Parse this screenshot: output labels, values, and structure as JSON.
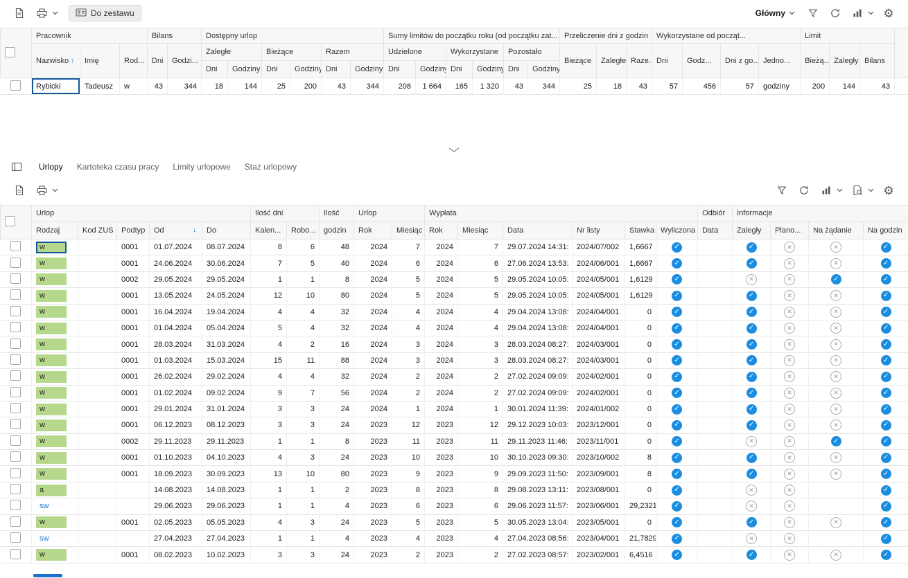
{
  "colors": {
    "accent_blue": "#1b8de0",
    "focus_border": "#12599c",
    "leave_green": "#b6d88d",
    "link_blue": "#1d79d2",
    "cross_gray": "#9c9c9c",
    "scrollbar_blue": "#1e6fd0",
    "header_bg": "#f7f7f7"
  },
  "toolbar_top": {
    "icons": [
      "open-icon",
      "print-icon",
      "print-dropdown-chevron-icon"
    ],
    "to_set_button_label": "Do zestawu",
    "view_selector_label": "Główny",
    "right_icons": [
      "filter-icon",
      "refresh-icon",
      "chart-icon",
      "chart-dropdown-chevron-icon",
      "settings-icon"
    ]
  },
  "employee_grid": {
    "sort": {
      "column": "Nazwisko",
      "direction": "asc"
    },
    "group_headers": {
      "pracownik": "Pracownik",
      "bilans": "Bilans",
      "dostepny_urlop": "Dostępny urlop",
      "sumy_limitow": "Sumy limitów do początku roku (od początku zat...",
      "przeliczenie": "Przeliczenie dni z godzin",
      "wykorzystane_od": "Wykorzystane od począt...",
      "limit": "Limit"
    },
    "sub_headers": {
      "nazwisko": "Nazwisko",
      "imie": "Imię",
      "rodzaj": "Rod...",
      "dni": "Dni",
      "godzi": "Godzi...",
      "zalegle": "Zaległe",
      "biezace": "Bieżące",
      "razem": "Razem",
      "udzielone": "Udzielone",
      "wykorzystane": "Wykorzystane",
      "pozostalo": "Pozostało",
      "raze": "Raze...",
      "godz": "Godz...",
      "dni_z_go": "Dni z go...",
      "jedno": "Jedno...",
      "bieza": "Bieżą...",
      "zalegly": "Zaległy",
      "bilans": "Bilans",
      "godziny": "Godziny"
    },
    "row": {
      "nazwisko": "Rybicki",
      "imie": "Tadeusz",
      "rodzaj": "w",
      "bilans_dni": "43",
      "bilans_godziny": "344",
      "zalegle_dni": "18",
      "zalegle_godziny": "144",
      "biezace_dni": "25",
      "biezace_godziny": "200",
      "razem_dni": "43",
      "razem_godziny": "344",
      "udzielone_dni": "208",
      "udzielone_godziny": "1 664",
      "wykorzystane_dni": "165",
      "wykorzystane_godziny": "1 320",
      "pozostalo_dni": "43",
      "pozostalo_godziny": "344",
      "przeliczenie_biezace": "25",
      "przeliczenie_zalegle": "18",
      "przeliczenie_razem": "43",
      "wyk_dni": "57",
      "wyk_godz": "456",
      "wyk_dni_z_godzin": "57",
      "wyk_jednostka": "godziny",
      "limit_biezacy": "200",
      "limit_zalegly": "144",
      "limit_bilans": "43"
    }
  },
  "splitter": {
    "icon": "collapse-chevron-icon"
  },
  "tabs": {
    "panel_icon": "panel-icon",
    "items": [
      {
        "label": "Urlopy",
        "active": true
      },
      {
        "label": "Kartoteka czasu pracy",
        "active": false
      },
      {
        "label": "Limity urlopowe",
        "active": false
      },
      {
        "label": "Staż urlopowy",
        "active": false
      }
    ]
  },
  "toolbar_leaves": {
    "icons": [
      "open-icon",
      "print-icon",
      "print-dropdown-chevron-icon"
    ],
    "right_icons": [
      "filter-icon",
      "refresh-icon",
      "chart-icon",
      "chart-dropdown-chevron-icon",
      "preview-icon",
      "preview-dropdown-chevron-icon",
      "settings-icon"
    ]
  },
  "leave_grid": {
    "sort": {
      "column": "Od",
      "direction": "desc"
    },
    "group_headers": {
      "urlop": "Urlop",
      "ilosc_dni": "Ilość dni",
      "ilosc": "Ilość",
      "urlop2": "Urlop",
      "wyplata": "Wypłata",
      "odbior": "Odbiór",
      "informacje": "Informacje"
    },
    "columns": {
      "rodzaj": "Rodzaj",
      "kod_zus": "Kod ZUS",
      "podtyp": "Podtyp",
      "od": "Od",
      "do": "Do",
      "kalen": "Kalen...",
      "robo": "Robo...",
      "godzin": "godzin",
      "rok": "Rok",
      "miesiac": "Miesiąc",
      "rok2": "Rok",
      "miesiac2": "Miesiąc",
      "data": "Data",
      "nr_listy": "Nr listy",
      "stawka": "Stawka",
      "wyliczona": "Wyliczona",
      "data2": "Data",
      "zalegly": "Zaległy",
      "plano": "Plano...",
      "na_zadanie": "Na żądanie",
      "na_godzine": "Na godzin"
    },
    "rows": [
      [
        "w",
        "",
        "0001",
        "01.07.2024",
        "08.07.2024",
        "8",
        "6",
        "48",
        "2024",
        "7",
        "2024",
        "7",
        "29.07.2024 14:31:",
        "2024/07/002",
        "1,6667",
        "check",
        "",
        "check",
        "cross",
        "cross",
        "check"
      ],
      [
        "w",
        "",
        "0001",
        "24.06.2024",
        "30.06.2024",
        "7",
        "5",
        "40",
        "2024",
        "6",
        "2024",
        "6",
        "27.06.2024 13:53:",
        "2024/06/001",
        "1,6667",
        "check",
        "",
        "check",
        "cross",
        "cross",
        "check"
      ],
      [
        "w",
        "",
        "0002",
        "29.05.2024",
        "29.05.2024",
        "1",
        "1",
        "8",
        "2024",
        "5",
        "2024",
        "5",
        "29.05.2024 10:05:",
        "2024/05/001",
        "1,6129",
        "check",
        "",
        "cross",
        "cross",
        "check",
        "check"
      ],
      [
        "w",
        "",
        "0001",
        "13.05.2024",
        "24.05.2024",
        "12",
        "10",
        "80",
        "2024",
        "5",
        "2024",
        "5",
        "29.05.2024 10:05:",
        "2024/05/001",
        "1,6129",
        "check",
        "",
        "check",
        "cross",
        "cross",
        "check"
      ],
      [
        "w",
        "",
        "0001",
        "16.04.2024",
        "19.04.2024",
        "4",
        "4",
        "32",
        "2024",
        "4",
        "2024",
        "4",
        "29.04.2024 13:08:",
        "2024/04/001",
        "0",
        "check",
        "",
        "check",
        "cross",
        "cross",
        "check"
      ],
      [
        "w",
        "",
        "0001",
        "01.04.2024",
        "05.04.2024",
        "5",
        "4",
        "32",
        "2024",
        "4",
        "2024",
        "4",
        "29.04.2024 13:08:",
        "2024/04/001",
        "0",
        "check",
        "",
        "check",
        "cross",
        "cross",
        "check"
      ],
      [
        "w",
        "",
        "0001",
        "28.03.2024",
        "31.03.2024",
        "4",
        "2",
        "16",
        "2024",
        "3",
        "2024",
        "3",
        "28.03.2024 08:27:",
        "2024/03/001",
        "0",
        "check",
        "",
        "check",
        "cross",
        "cross",
        "check"
      ],
      [
        "w",
        "",
        "0001",
        "01.03.2024",
        "15.03.2024",
        "15",
        "11",
        "88",
        "2024",
        "3",
        "2024",
        "3",
        "28.03.2024 08:27:",
        "2024/03/001",
        "0",
        "check",
        "",
        "check",
        "cross",
        "cross",
        "check"
      ],
      [
        "w",
        "",
        "0001",
        "26.02.2024",
        "29.02.2024",
        "4",
        "4",
        "32",
        "2024",
        "2",
        "2024",
        "2",
        "27.02.2024 09:09:",
        "2024/02/001",
        "0",
        "check",
        "",
        "check",
        "cross",
        "cross",
        "check"
      ],
      [
        "w",
        "",
        "0001",
        "01.02.2024",
        "09.02.2024",
        "9",
        "7",
        "56",
        "2024",
        "2",
        "2024",
        "2",
        "27.02.2024 09:09:",
        "2024/02/001",
        "0",
        "check",
        "",
        "check",
        "cross",
        "cross",
        "check"
      ],
      [
        "w",
        "",
        "0001",
        "29.01.2024",
        "31.01.2024",
        "3",
        "3",
        "24",
        "2024",
        "1",
        "2024",
        "1",
        "30.01.2024 11:39:",
        "2024/01/002",
        "0",
        "check",
        "",
        "check",
        "cross",
        "cross",
        "check"
      ],
      [
        "w",
        "",
        "0001",
        "06.12.2023",
        "08.12.2023",
        "3",
        "3",
        "24",
        "2023",
        "12",
        "2023",
        "12",
        "29.12.2023 10:03:",
        "2023/12/001",
        "0",
        "check",
        "",
        "check",
        "cross",
        "cross",
        "check"
      ],
      [
        "w",
        "",
        "0002",
        "29.11.2023",
        "29.11.2023",
        "1",
        "1",
        "8",
        "2023",
        "11",
        "2023",
        "11",
        "29.11.2023 11:46:",
        "2023/11/001",
        "0",
        "check",
        "",
        "cross",
        "cross",
        "check",
        "check"
      ],
      [
        "w",
        "",
        "0001",
        "01.10.2023",
        "04.10.2023",
        "4",
        "3",
        "24",
        "2023",
        "10",
        "2023",
        "10",
        "30.10.2023 09:30:",
        "2023/10/002",
        "8",
        "check",
        "",
        "check",
        "cross",
        "cross",
        "check"
      ],
      [
        "w",
        "",
        "0001",
        "18.09.2023",
        "30.09.2023",
        "13",
        "10",
        "80",
        "2023",
        "9",
        "2023",
        "9",
        "29.09.2023 11:50:",
        "2023/09/001",
        "8",
        "check",
        "",
        "check",
        "cross",
        "cross",
        "check"
      ],
      [
        "a",
        "",
        "",
        "14.08.2023",
        "14.08.2023",
        "1",
        "1",
        "2",
        "2023",
        "8",
        "2023",
        "8",
        "29.08.2023 13:11:",
        "2023/08/001",
        "0",
        "check",
        "",
        "cross",
        "cross",
        "",
        "check"
      ],
      [
        "sw",
        "",
        "",
        "29.06.2023",
        "29.06.2023",
        "1",
        "1",
        "4",
        "2023",
        "6",
        "2023",
        "6",
        "29.06.2023 11:57:",
        "2023/06/001",
        "29,2321",
        "check",
        "",
        "cross",
        "cross",
        "",
        "check"
      ],
      [
        "w",
        "",
        "0001",
        "02.05.2023",
        "05.05.2023",
        "4",
        "3",
        "24",
        "2023",
        "5",
        "2023",
        "5",
        "30.05.2023 13:04:",
        "2023/05/001",
        "0",
        "check",
        "",
        "check",
        "cross",
        "cross",
        "check"
      ],
      [
        "sw",
        "",
        "",
        "27.04.2023",
        "27.04.2023",
        "1",
        "1",
        "4",
        "2023",
        "4",
        "2023",
        "4",
        "27.04.2023 08:56:",
        "2023/04/001",
        "21,7829",
        "check",
        "",
        "cross",
        "cross",
        "",
        "check"
      ],
      [
        "w",
        "",
        "0001",
        "08.02.2023",
        "10.02.2023",
        "3",
        "3",
        "24",
        "2023",
        "2",
        "2023",
        "2",
        "27.02.2023 08:57:",
        "2023/02/001",
        "6,4516",
        "check",
        "",
        "check",
        "cross",
        "cross",
        "check"
      ]
    ]
  }
}
